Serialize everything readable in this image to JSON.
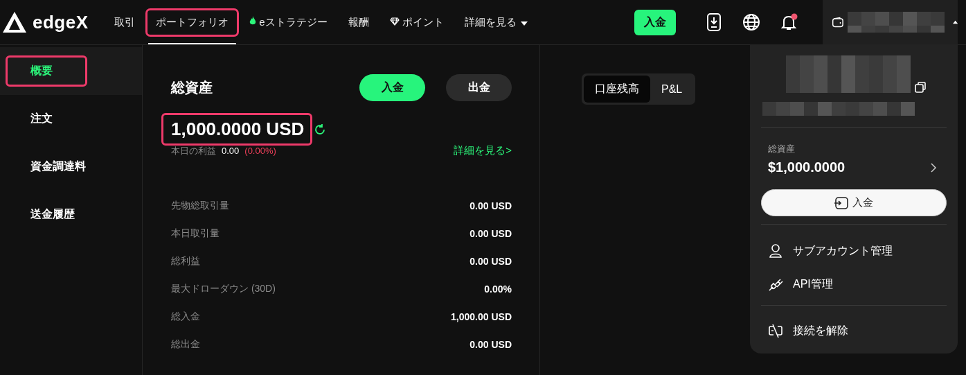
{
  "logo": {
    "text": "edgeX"
  },
  "nav": [
    {
      "label": "取引",
      "selected": false,
      "highlighted": false
    },
    {
      "label": "ポートフォリオ",
      "selected": true,
      "highlighted": true
    },
    {
      "label": "eストラテジー",
      "selected": false,
      "highlighted": false
    },
    {
      "label": "報酬",
      "selected": false,
      "highlighted": false
    },
    {
      "label": "ポイント",
      "selected": false,
      "highlighted": false
    },
    {
      "label": "詳細を見る",
      "selected": false,
      "highlighted": false,
      "dropdown": true
    }
  ],
  "header_actions": {
    "deposit_button": "入金",
    "notifications_unread": true,
    "account_menu_open": true
  },
  "sidebar": {
    "items": [
      {
        "label": "概要",
        "selected": true,
        "highlighted": true
      },
      {
        "label": "注文",
        "selected": false,
        "highlighted": false
      },
      {
        "label": "資金調達料",
        "selected": false,
        "highlighted": false
      },
      {
        "label": "送金履歴",
        "selected": false,
        "highlighted": false
      }
    ]
  },
  "summary": {
    "title": "総資産",
    "buttons": [
      {
        "label": "入金",
        "kind": "primary"
      },
      {
        "label": "出金",
        "kind": "secondary"
      }
    ],
    "balance": {
      "value": "1,000.0000 USD",
      "highlighted": true
    },
    "today": {
      "label": "本日の利益",
      "value": "0.00",
      "change": "(0.00%)"
    },
    "details_link": "詳細を見る>",
    "stats": [
      {
        "label": "先物総取引量",
        "value": "0.00 USD"
      },
      {
        "label": "本日取引量",
        "value": "0.00 USD"
      },
      {
        "label": "総利益",
        "value": "0.00 USD"
      },
      {
        "label": "最大ドローダウン (30D)",
        "value": "0.00%"
      },
      {
        "label": "総入金",
        "value": "1,000.00 USD"
      },
      {
        "label": "総出金",
        "value": "0.00 USD"
      }
    ]
  },
  "chart_tabs": [
    {
      "label": "口座残高",
      "selected": true
    },
    {
      "label": "P&L",
      "selected": false
    }
  ],
  "account_menu": {
    "total_label": "総資産",
    "total_value": "$1,000.0000",
    "deposit_button": "入金",
    "items": [
      {
        "label": "サブアカウント管理"
      },
      {
        "label": "API管理"
      }
    ],
    "disconnect": "接続を解除"
  }
}
